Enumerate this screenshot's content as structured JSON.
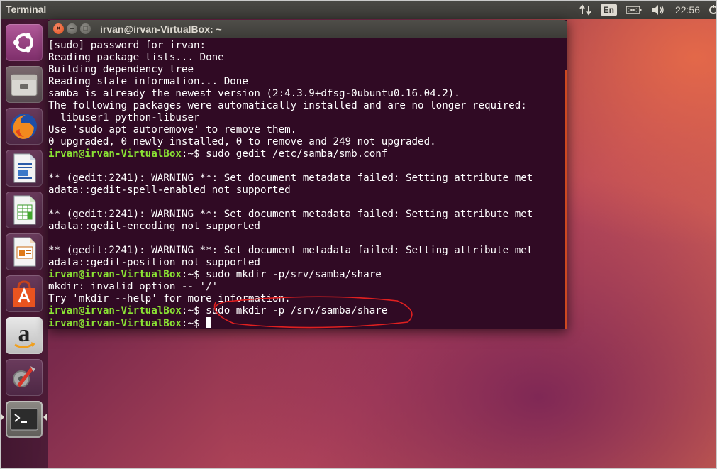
{
  "top_panel": {
    "app_title": "Terminal",
    "lang_indicator": "En",
    "clock": "22:56",
    "icons": [
      "network-updown-icon",
      "keyboard-language-icon",
      "battery-icon",
      "volume-icon",
      "power-gear-icon"
    ]
  },
  "launcher": {
    "items": [
      {
        "name": "ubuntu-dash-icon",
        "label": "Search your computer"
      },
      {
        "name": "files-icon",
        "label": "Files"
      },
      {
        "name": "firefox-icon",
        "label": "Firefox Web Browser"
      },
      {
        "name": "libreoffice-writer-icon",
        "label": "LibreOffice Writer"
      },
      {
        "name": "libreoffice-calc-icon",
        "label": "LibreOffice Calc"
      },
      {
        "name": "libreoffice-impress-icon",
        "label": "LibreOffice Impress"
      },
      {
        "name": "ubuntu-software-icon",
        "label": "Ubuntu Software"
      },
      {
        "name": "amazon-icon",
        "label": "Amazon"
      },
      {
        "name": "system-settings-icon",
        "label": "System Settings"
      },
      {
        "name": "terminal-icon",
        "label": "Terminal"
      }
    ]
  },
  "window": {
    "title": "irvan@irvan-VirtualBox: ~"
  },
  "terminal": {
    "prompt_user": "irvan@irvan-VirtualBox",
    "prompt_tail": ":~$ ",
    "lines": [
      {
        "type": "text",
        "text": "[sudo] password for irvan:"
      },
      {
        "type": "text",
        "text": "Reading package lists... Done"
      },
      {
        "type": "text",
        "text": "Building dependency tree"
      },
      {
        "type": "text",
        "text": "Reading state information... Done"
      },
      {
        "type": "text",
        "text": "samba is already the newest version (2:4.3.9+dfsg-0ubuntu0.16.04.2)."
      },
      {
        "type": "text",
        "text": "The following packages were automatically installed and are no longer required:"
      },
      {
        "type": "text",
        "text": "  libuser1 python-libuser"
      },
      {
        "type": "text",
        "text": "Use 'sudo apt autoremove' to remove them."
      },
      {
        "type": "text",
        "text": "0 upgraded, 0 newly installed, 0 to remove and 249 not upgraded."
      },
      {
        "type": "prompt",
        "cmd": "sudo gedit /etc/samba/smb.conf"
      },
      {
        "type": "text",
        "text": ""
      },
      {
        "type": "text",
        "text": "** (gedit:2241): WARNING **: Set document metadata failed: Setting attribute met"
      },
      {
        "type": "text",
        "text": "adata::gedit-spell-enabled not supported"
      },
      {
        "type": "text",
        "text": ""
      },
      {
        "type": "text",
        "text": "** (gedit:2241): WARNING **: Set document metadata failed: Setting attribute met"
      },
      {
        "type": "text",
        "text": "adata::gedit-encoding not supported"
      },
      {
        "type": "text",
        "text": ""
      },
      {
        "type": "text",
        "text": "** (gedit:2241): WARNING **: Set document metadata failed: Setting attribute met"
      },
      {
        "type": "text",
        "text": "adata::gedit-position not supported"
      },
      {
        "type": "prompt",
        "cmd": "sudo mkdir -p/srv/samba/share"
      },
      {
        "type": "text",
        "text": "mkdir: invalid option -- '/'"
      },
      {
        "type": "text",
        "text": "Try 'mkdir --help' for more information."
      },
      {
        "type": "prompt",
        "cmd": "sudo mkdir -p /srv/samba/share"
      },
      {
        "type": "prompt",
        "cmd": "",
        "cursor": true
      }
    ]
  },
  "colors": {
    "terminal_bg": "#300a24",
    "prompt_green": "#8ae234",
    "annotation_red": "#e02020",
    "ubuntu_orange": "#e95420"
  }
}
